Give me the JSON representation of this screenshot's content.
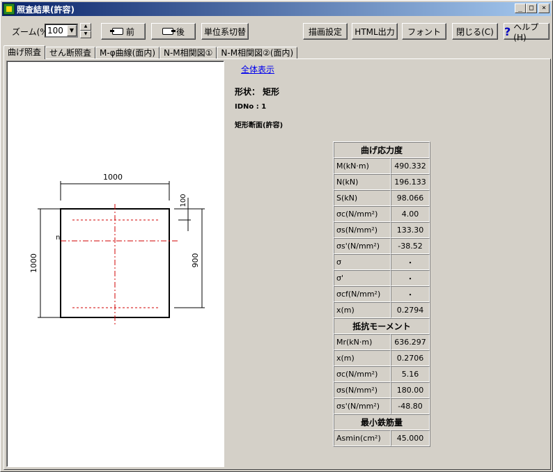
{
  "window": {
    "title": "照査結果(許容)",
    "buttons": {
      "minimize": "_",
      "maximize": "□",
      "close": "×"
    }
  },
  "toolbar": {
    "zoom_label": "ズーム(%)",
    "zoom_value": "100",
    "prev_label": "前",
    "next_label": "後",
    "unit_switch_label": "単位系切替",
    "draw_settings_label": "描画設定",
    "html_output_label": "HTML出力",
    "font_label": "フォント",
    "close_label": "閉じる(C)",
    "help_label": "ヘルプ(H)"
  },
  "tabs": [
    {
      "label": "曲げ照査",
      "active": true
    },
    {
      "label": "せん断照査",
      "active": false
    },
    {
      "label": "M-φ曲線(面内)",
      "active": false
    },
    {
      "label": "N-M相関図①",
      "active": false
    },
    {
      "label": "N-M相関図②(面内)",
      "active": false
    }
  ],
  "drawing": {
    "width_label": "1000",
    "height_label": "1000",
    "depth_label": "900",
    "cover_label": "100",
    "neutral_label": "n"
  },
  "info": {
    "show_all": "全体表示",
    "shape": "形状： 矩形",
    "idno": "IDNo : 1",
    "section": "矩形断面(許容)"
  },
  "results": {
    "bending_header": "曲げ応力度",
    "bending_rows": [
      {
        "label": "M(kN·m)",
        "value": "490.332"
      },
      {
        "label": "N(kN)",
        "value": "196.133"
      },
      {
        "label": "S(kN)",
        "value": "98.066"
      },
      {
        "label": "σc(N/mm²)",
        "value": "4.00"
      },
      {
        "label": "σs(N/mm²)",
        "value": "133.30"
      },
      {
        "label": "σs'(N/mm²)",
        "value": "-38.52"
      },
      {
        "label": "σ",
        "value": "・"
      },
      {
        "label": "σ'",
        "value": "・"
      },
      {
        "label": "σcf(N/mm²)",
        "value": "・"
      },
      {
        "label": "x(m)",
        "value": "0.2794"
      }
    ],
    "resist_header": "抵抗モーメント",
    "resist_rows": [
      {
        "label": "Mr(kN·m)",
        "value": "636.297"
      },
      {
        "label": "x(m)",
        "value": "0.2706"
      },
      {
        "label": "σc(N/mm²)",
        "value": "5.16"
      },
      {
        "label": "σs(N/mm²)",
        "value": "180.00"
      },
      {
        "label": "σs'(N/mm²)",
        "value": "-48.80"
      }
    ],
    "min_rebar_header": "最小鉄筋量",
    "min_rebar_rows": [
      {
        "label": "Asmin(cm²)",
        "value": "45.000"
      }
    ]
  }
}
